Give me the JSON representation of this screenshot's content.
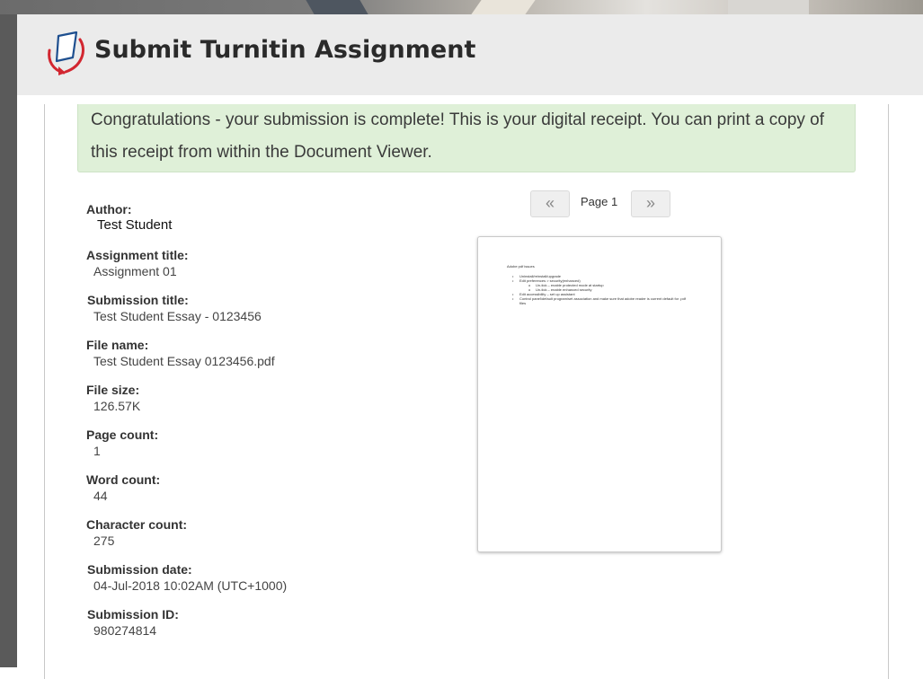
{
  "header": {
    "title": "Submit Turnitin Assignment",
    "logo_icon": "turnitin-logo-icon"
  },
  "alert": {
    "message": "Congratulations - your submission is complete! This is your digital receipt. You can print a copy of this receipt from within the Document Viewer."
  },
  "receipt": {
    "author": {
      "label": "Author:",
      "value": "Test Student"
    },
    "assignment_title": {
      "label": "Assignment title:",
      "value": "Assignment 01"
    },
    "submission_title": {
      "label": "Submission title:",
      "value": "Test Student Essay - 0123456"
    },
    "file_name": {
      "label": "File name:",
      "value": "Test Student Essay 0123456.pdf"
    },
    "file_size": {
      "label": "File size:",
      "value": "126.57K"
    },
    "page_count": {
      "label": "Page count:",
      "value": "1"
    },
    "word_count": {
      "label": "Word count:",
      "value": "44"
    },
    "character_count": {
      "label": "Character count:",
      "value": "275"
    },
    "submission_date": {
      "label": "Submission date:",
      "value": "04-Jul-2018 10:02AM (UTC+1000)"
    },
    "submission_id": {
      "label": "Submission ID:",
      "value": "980274814"
    }
  },
  "viewer": {
    "prev_label": "«",
    "next_label": "»",
    "page_label": "Page 1",
    "preview": {
      "heading": "Adobe pdf issues",
      "items": [
        {
          "level": 1,
          "text": "Uninstall/reinstall/upgrade"
        },
        {
          "level": 1,
          "text": "Edit preferences > security(enhanced)"
        },
        {
          "level": 2,
          "text": "Un-tick – enable protected mode at startup"
        },
        {
          "level": 2,
          "text": "Un-tick – enable enhanced security"
        },
        {
          "level": 1,
          "text": "Edit accessibility – set up assistant"
        },
        {
          "level": 1,
          "text": "Control panel\\default program\\set association and make sure that adobe reader is current default for .pdf files"
        }
      ]
    }
  },
  "colors": {
    "alert_bg": "#dff0d8",
    "header_bg": "#ebebeb",
    "logo_red": "#d22630",
    "logo_blue": "#1e4f8f"
  }
}
